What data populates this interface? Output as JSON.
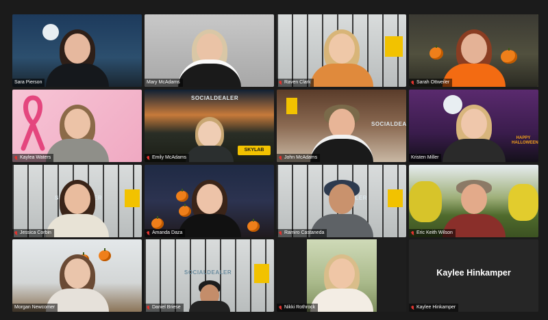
{
  "participants": [
    {
      "name": "Sara Pierson",
      "muted": false
    },
    {
      "name": "Mary McAdams",
      "muted": false
    },
    {
      "name": "Raven Clark",
      "muted": true
    },
    {
      "name": "Sarah Ottweiler",
      "muted": true
    },
    {
      "name": "Kaylea Waters",
      "muted": true
    },
    {
      "name": "Emily McAdams",
      "muted": true
    },
    {
      "name": "John McAdams",
      "muted": true
    },
    {
      "name": "Kristen Miller",
      "muted": false
    },
    {
      "name": "Jessica Corbin",
      "muted": true
    },
    {
      "name": "Amanda Daza",
      "muted": true
    },
    {
      "name": "Ramiro Castaneda",
      "muted": true
    },
    {
      "name": "Eric Keith Wilson",
      "muted": true
    },
    {
      "name": "Morgan Newcomer",
      "muted": false
    },
    {
      "name": "Daniel Briese",
      "muted": true
    },
    {
      "name": "Nikki Rothrock",
      "muted": true
    },
    {
      "name": "Kaylee Hinkamper",
      "muted": true
    }
  ],
  "no_video_display_name": "Kaylee Hinkamper",
  "active_speaker": "Sarah Ottweiler",
  "brand_text": {
    "socialdealer": "SOCIALDEALER",
    "dealer": "DEALER",
    "skylab": "SKYLAB",
    "happy_halloween": "HAPPY HALLOWEEN"
  },
  "colors": {
    "background": "#1b1b1b",
    "active_outline": "#c9e04a",
    "muted_icon": "#e0342f",
    "brand_yellow": "#f2c200"
  }
}
